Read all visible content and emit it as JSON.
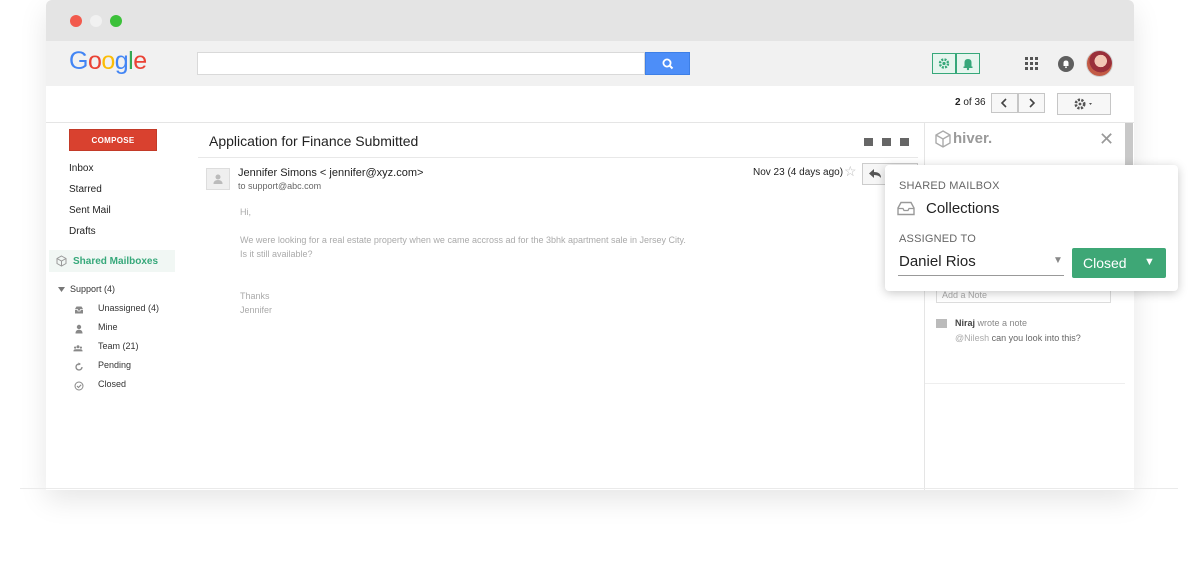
{
  "header": {
    "logo_letters": [
      {
        "ch": "G",
        "color": "#4285F4"
      },
      {
        "ch": "o",
        "color": "#EA4335"
      },
      {
        "ch": "o",
        "color": "#FBBC05"
      },
      {
        "ch": "g",
        "color": "#4285F4"
      },
      {
        "ch": "l",
        "color": "#34A853"
      },
      {
        "ch": "e",
        "color": "#EA4335"
      }
    ],
    "search_value": ""
  },
  "toolbar": {
    "pager_current": "2",
    "pager_rest": " of 36"
  },
  "sidebar": {
    "compose_label": "COMPOSE",
    "items": [
      "Inbox",
      "Starred",
      "Sent Mail",
      "Drafts"
    ],
    "shared_mailboxes_label": "Shared Mailboxes",
    "support_label": "Support (4)",
    "sub_items": [
      {
        "label": "Unassigned (4)",
        "icon": "inbox-icon"
      },
      {
        "label": "Mine",
        "icon": "person-icon"
      },
      {
        "label": "Team (21)",
        "icon": "team-icon"
      },
      {
        "label": "Pending",
        "icon": "pending-icon"
      },
      {
        "label": "Closed",
        "icon": "check-circle-icon"
      }
    ]
  },
  "email": {
    "subject": "Application for Finance Submitted",
    "sender": "Jennifer Simons < jennifer@xyz.com>",
    "to": "to support@abc.com",
    "date": "Nov 23 (4 days ago)",
    "body": [
      "Hi,",
      "We were looking for a real estate property when we came accross ad for the 3bhk apartment sale in Jersey City.",
      "Is it still available?",
      "Thanks",
      "Jennifer"
    ]
  },
  "hiver_panel": {
    "brand": "hiver.",
    "add_note_placeholder": "Add a Note",
    "note_author": "Niraj",
    "note_action": " wrote a note",
    "note_mention": "@Nilesh",
    "note_text": " can you look into this?"
  },
  "popup": {
    "shared_mailbox_label": "SHARED MAILBOX",
    "mailbox_name": "Collections",
    "assigned_to_label": "ASSIGNED TO",
    "assignee": "Daniel Rios",
    "status_label": "Closed"
  },
  "colors": {
    "compose": "#d9412f",
    "hiver_green": "#3ea776",
    "search_blue": "#4d8ef8"
  }
}
